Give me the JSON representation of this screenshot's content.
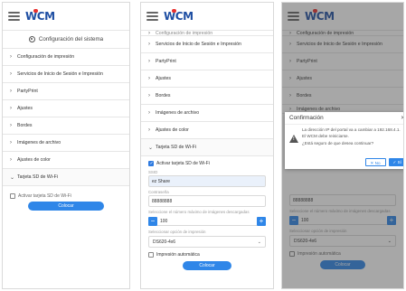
{
  "logo": {
    "text_w": "W",
    "text_c": "C",
    "text_m": "M"
  },
  "panel1": {
    "section_title": "Configuración del sistema",
    "items": [
      "Configuración de impresión",
      "Servicios de Inicio de Sesión e Impresión",
      "PartyPrint",
      "Ajustes",
      "Bordes",
      "Imágenes de archivo",
      "Ajustes de color",
      "Tarjeta SD de Wi-Fi"
    ],
    "checkbox_label": "Activar tarjeta SD de Wi-Fi",
    "save_label": "Colocar"
  },
  "panel2": {
    "top_cut": "Configuración de impresión",
    "items": [
      "Servicios de Inicio de Sesión e Impresión",
      "PartyPrint",
      "Ajustes",
      "Bordes",
      "Imágenes de archivo",
      "Ajustes de color",
      "Tarjeta SD de Wi-Fi"
    ],
    "checkbox_label": "Activar tarjeta SD de Wi-Fi",
    "ssid_label": "SSID",
    "ssid_value": "ez Share",
    "password_label": "Contraseña",
    "password_value": "88888888",
    "max_images_label": "Seleccione el número máximo de imágenes descargadas",
    "max_images_value": "100",
    "printer_label": "Seleccionar opción de impresión",
    "printer_value": "DS620-4x6",
    "auto_print_label": "Impresión automática",
    "save_label": "Colocar"
  },
  "panel3": {
    "top_cut": "Configuración de impresión",
    "items": [
      "Servicios de Inicio de Sesión e Impresión",
      "PartyPrint",
      "Ajustes",
      "Bordes",
      "Imágenes de archivo"
    ],
    "password_value": "88888888",
    "max_images_label": "Seleccione el número máximo de imágenes descargadas",
    "max_images_value": "100",
    "printer_label": "Seleccionar opción de impresión",
    "printer_value": "DS620-4x6",
    "auto_print_label": "Impresión automática",
    "save_label": "Colocar",
    "modal": {
      "title": "Confirmación",
      "line1": "La dirección IP del portal va a cambiar a 192.168.4.1.",
      "line2": "El WCM debe reiniciarse.",
      "line3": "¿Está seguro de que desea continuar?",
      "no_label": "No",
      "yes_label": "Sí"
    }
  },
  "colors": {
    "accent": "#2f86e8",
    "brand_blue": "#1f4fa3",
    "brand_red": "#e8312f"
  }
}
